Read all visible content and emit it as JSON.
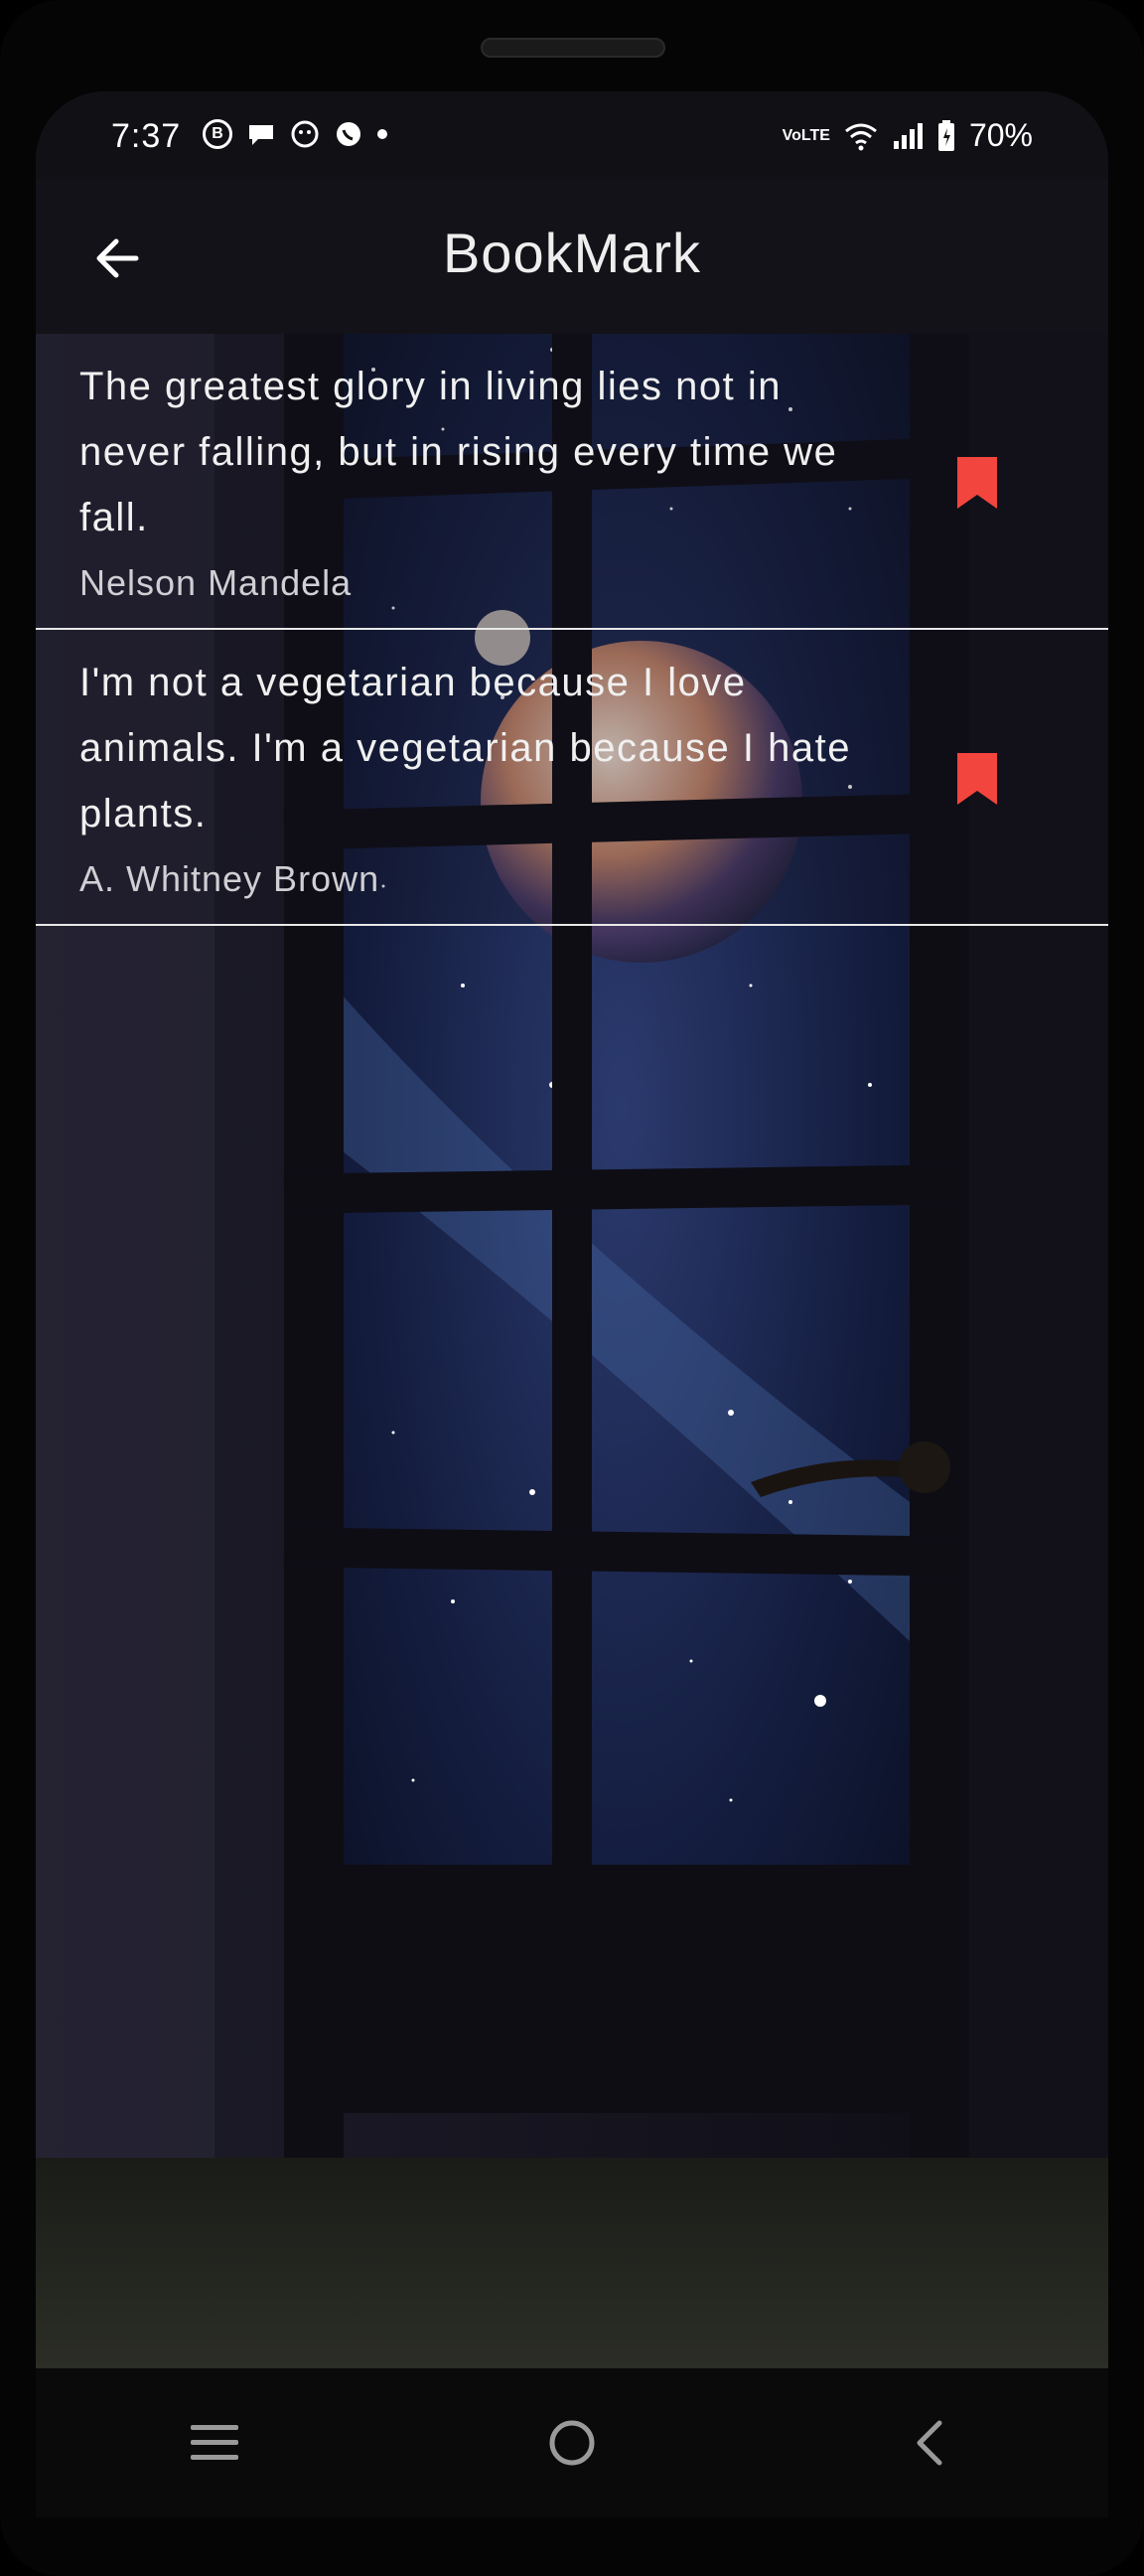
{
  "status_bar": {
    "time": "7:37",
    "notification_icons": [
      "b-icon",
      "chat-icon",
      "face-icon",
      "whatsapp-icon"
    ],
    "battery": "70%",
    "network": "VoLTE"
  },
  "app_bar": {
    "title": "BookMark"
  },
  "bookmarks": [
    {
      "quote": "The greatest glory in living lies not in never falling, but in rising every time we fall.",
      "author": "Nelson Mandela"
    },
    {
      "quote": "I'm not a vegetarian because I love animals. I'm a vegetarian because I hate plants.",
      "author": "A. Whitney Brown"
    }
  ],
  "colors": {
    "bookmark": "#f2453d",
    "app_bar": "#131218",
    "divider": "#e8e8e8"
  },
  "icons": {
    "back": "arrow-back-icon",
    "bookmark": "bookmark-icon",
    "nav_menu": "menu-icon",
    "nav_home": "home-icon",
    "nav_back": "chevron-left-icon"
  }
}
